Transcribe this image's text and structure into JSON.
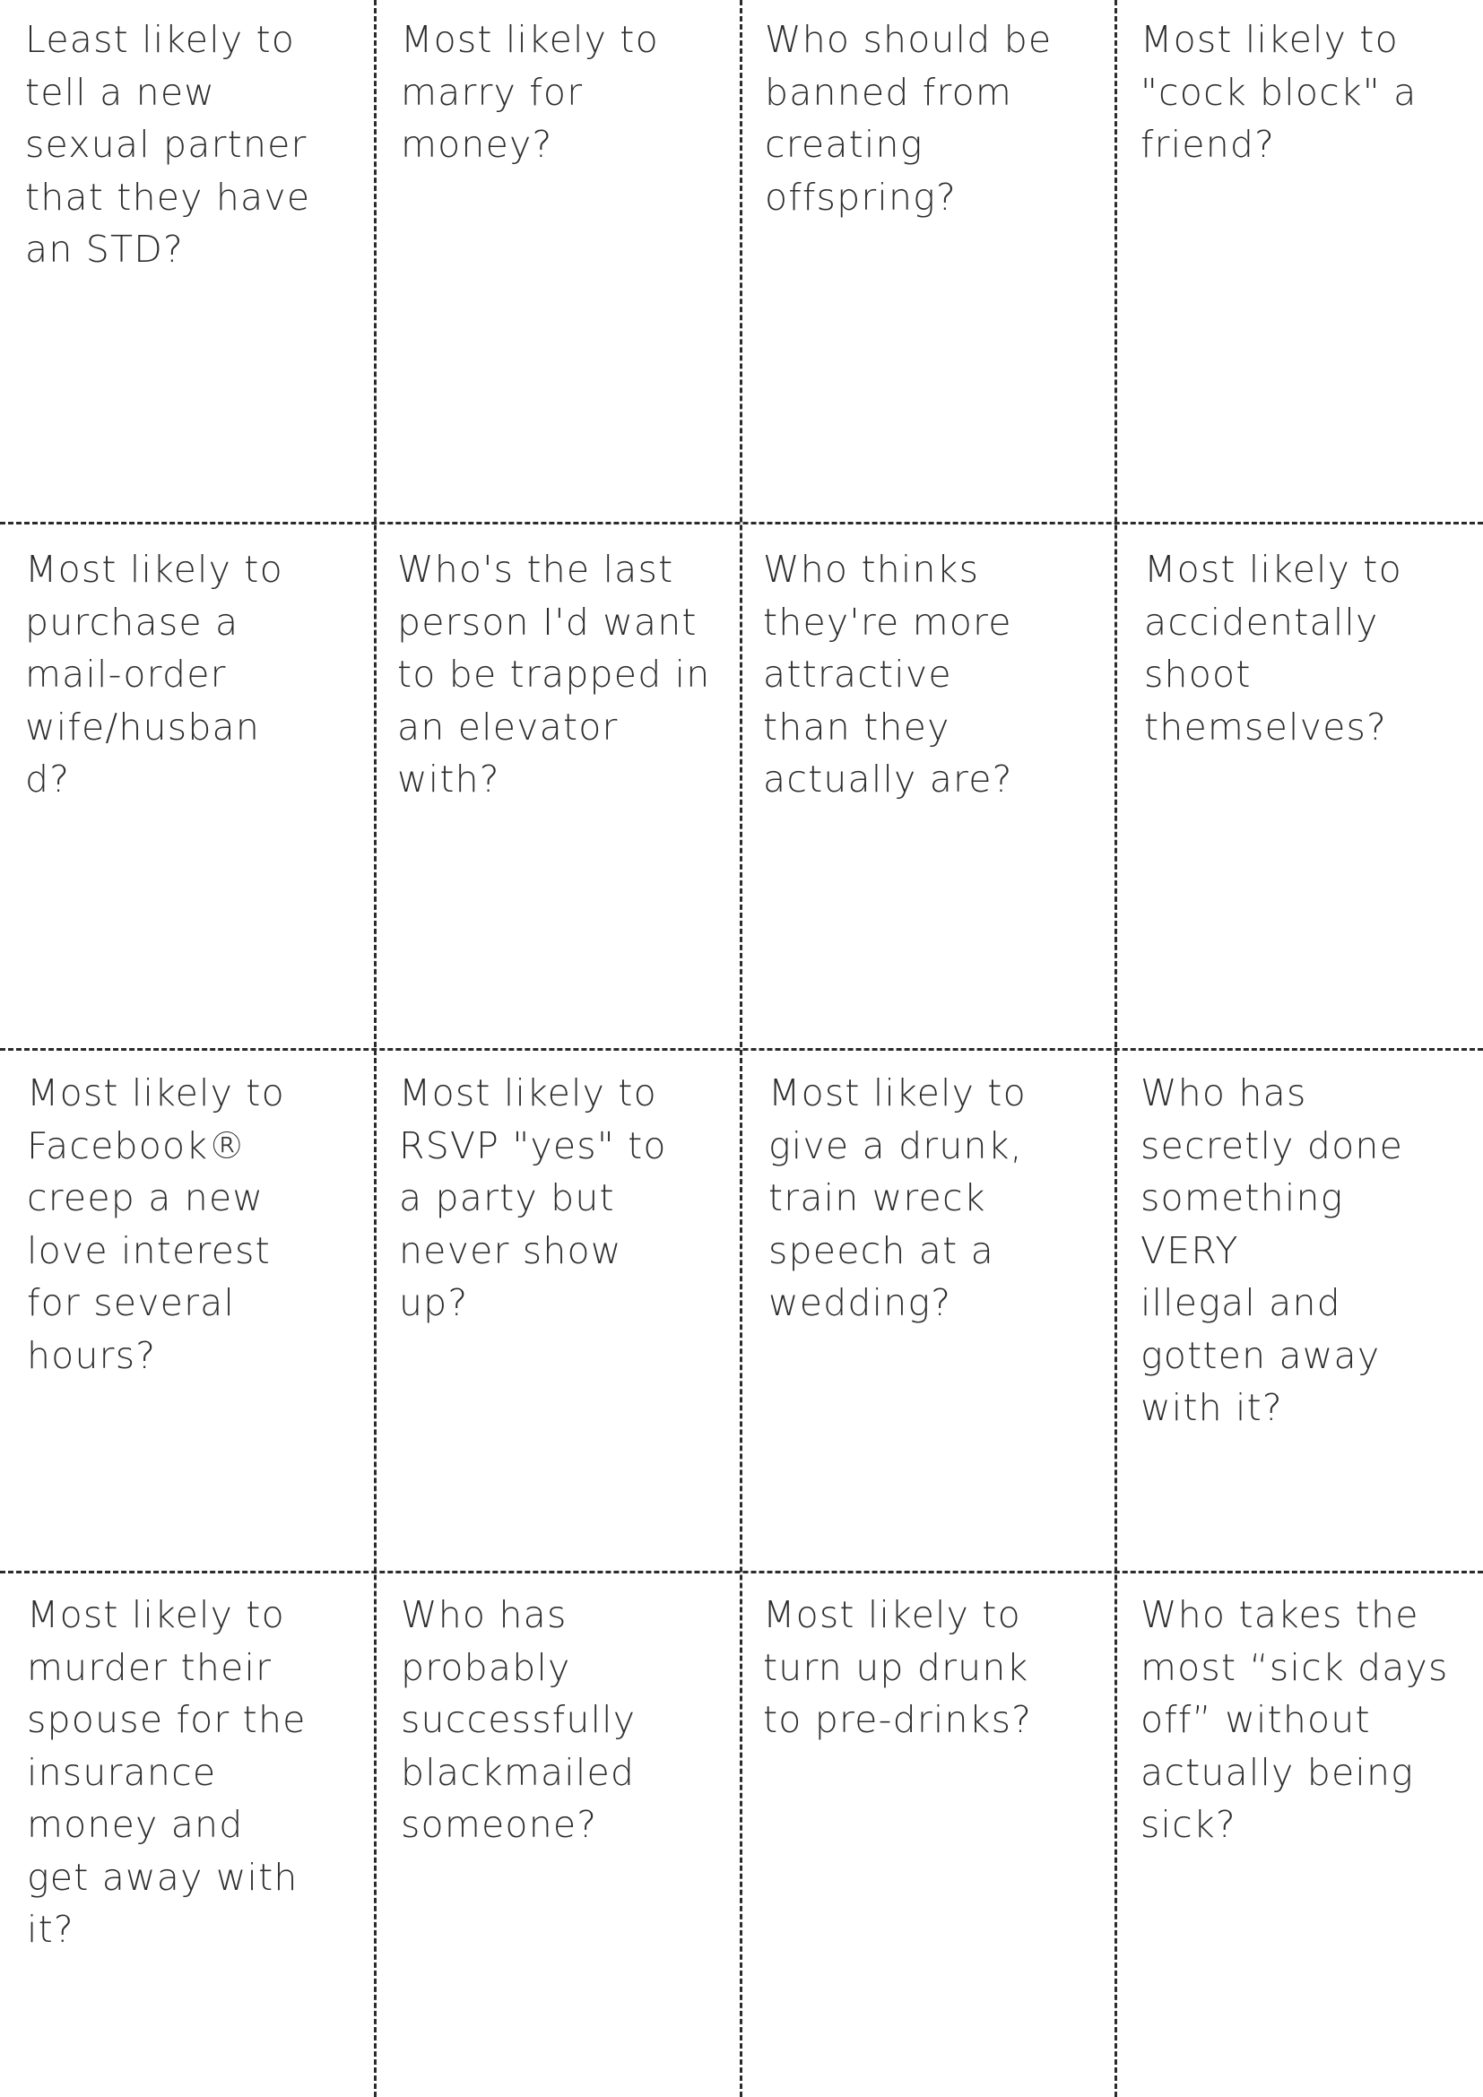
{
  "cards": [
    {
      "text": "Least likely to\ntell a new\nsexual partner\nthat they have\nan STD?"
    },
    {
      "text": "Most likely to\nmarry for\nmoney?"
    },
    {
      "text": "Who should be\nbanned from\ncreating\noffspring?"
    },
    {
      "text": "Most likely to\n\"cock block\" a\nfriend?"
    },
    {
      "text": "Most likely to\npurchase a\nmail-order\nwife/husban\nd?"
    },
    {
      "text": "Who's the last\nperson I'd want\nto be trapped in\nan elevator\nwith?"
    },
    {
      "text": "Who thinks\nthey're more\nattractive\nthan they\nactually are?"
    },
    {
      "text": "Most likely to\naccidentally\nshoot\nthemselves?"
    },
    {
      "text": "Most likely to\nFacebook®\ncreep a new\nlove interest\nfor several\nhours?"
    },
    {
      "text": "Most likely to\nRSVP \"yes\" to\na party but\nnever show\nup?"
    },
    {
      "text": "Most likely to\ngive a drunk,\ntrain wreck\nspeech at a\nwedding?"
    },
    {
      "text": "Who has\nsecretly done\nsomething\nVERY\nillegal and\ngotten away\nwith it?"
    },
    {
      "text": "Most likely to\nmurder their\nspouse for the\ninsurance\nmoney and\nget away with\nit?"
    },
    {
      "text": "Who has\nprobably\nsuccessfully\nblackmailed\nsomeone?"
    },
    {
      "text": "Most likely to\nturn up drunk\nto pre-drinks?"
    },
    {
      "text": "Who takes the\nmost “sick days\noff” without\nactually being\nsick?"
    }
  ]
}
